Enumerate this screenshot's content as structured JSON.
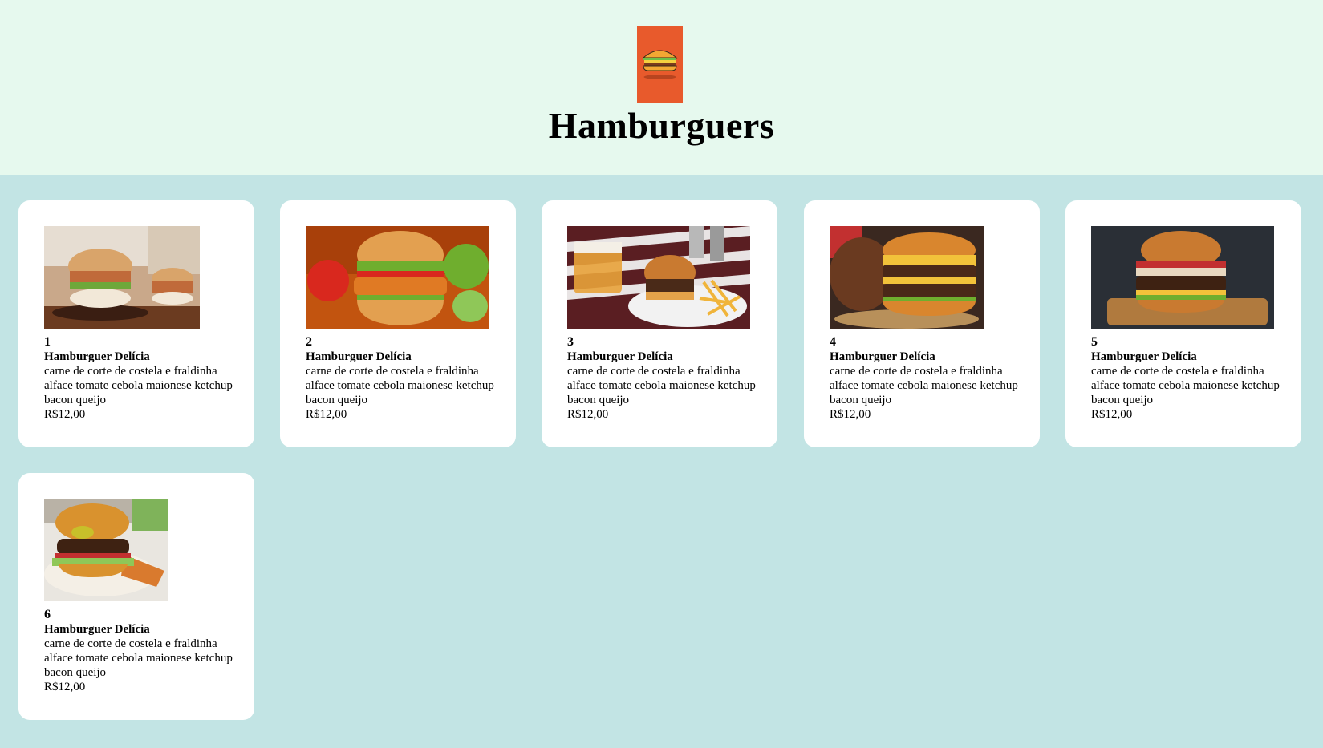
{
  "header": {
    "logo_icon": "hamburger-icon",
    "title": "Hamburguers"
  },
  "colors": {
    "header_bg": "#e6f9ee",
    "page_bg": "#c2e4e4",
    "logo_bg": "#e85a2c",
    "card_bg": "#ffffff"
  },
  "products": [
    {
      "number": "1",
      "name": "Hamburguer Delícia",
      "description": "carne de corte de costela e fraldinha alface tomate cebola maionese ketchup bacon queijo",
      "price": "R$12,00",
      "image": "burger-photo-1"
    },
    {
      "number": "2",
      "name": "Hamburguer Delícia",
      "description": "carne de corte de costela e fraldinha alface tomate cebola maionese ketchup bacon queijo",
      "price": "R$12,00",
      "image": "burger-photo-2"
    },
    {
      "number": "3",
      "name": "Hamburguer Delícia",
      "description": "carne de corte de costela e fraldinha alface tomate cebola maionese ketchup bacon queijo",
      "price": "R$12,00",
      "image": "burger-photo-3"
    },
    {
      "number": "4",
      "name": "Hamburguer Delícia",
      "description": "carne de corte de costela e fraldinha alface tomate cebola maionese ketchup bacon queijo",
      "price": "R$12,00",
      "image": "burger-photo-4"
    },
    {
      "number": "5",
      "name": "Hamburguer Delícia",
      "description": "carne de corte de costela e fraldinha alface tomate cebola maionese ketchup bacon queijo",
      "price": "R$12,00",
      "image": "burger-photo-5"
    },
    {
      "number": "6",
      "name": "Hamburguer Delícia",
      "description": "carne de corte de costela e fraldinha alface tomate cebola maionese ketchup bacon queijo",
      "price": "R$12,00",
      "image": "burger-photo-6"
    }
  ]
}
